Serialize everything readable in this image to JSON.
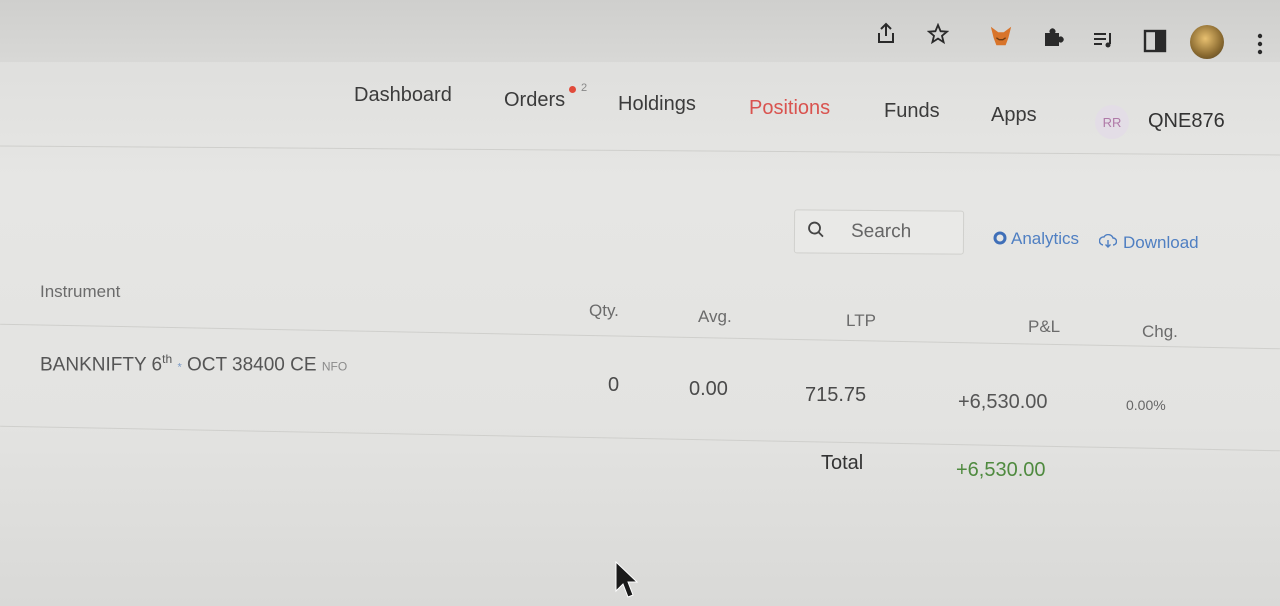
{
  "browser": {
    "icons": [
      "share-icon",
      "star-icon",
      "fox-extension-icon",
      "puzzle-extension-icon",
      "media-queue-icon",
      "side-panel-icon",
      "profile-avatar",
      "more-menu-icon"
    ]
  },
  "nav": {
    "items": [
      {
        "label": "Dashboard"
      },
      {
        "label": "Orders",
        "badge": "2"
      },
      {
        "label": "Holdings"
      },
      {
        "label": "Positions"
      },
      {
        "label": "Funds"
      },
      {
        "label": "Apps"
      }
    ],
    "user_initials": "RR",
    "user_id": "QNE876"
  },
  "toolbar": {
    "search_placeholder": "Search",
    "analytics_label": "Analytics",
    "download_label": "Download"
  },
  "table": {
    "headers": {
      "instrument": "Instrument",
      "qty": "Qty.",
      "avg": "Avg.",
      "ltp": "LTP",
      "pnl": "P&L",
      "chg": "Chg."
    },
    "rows": [
      {
        "instrument_prefix": "BANKNIFTY 6",
        "instrument_sup": "th",
        "instrument_mark": "*",
        "instrument_suffix": "OCT 38400 CE",
        "exchange": "NFO",
        "qty": "0",
        "avg": "0.00",
        "ltp": "715.75",
        "pnl": "+6,530.00",
        "chg": "0.00%"
      }
    ],
    "total_label": "Total",
    "total_value": "+6,530.00"
  },
  "colors": {
    "active_nav": "#d9534f",
    "profit_green": "#4f8a3f",
    "link_blue": "#4f7fc2"
  }
}
